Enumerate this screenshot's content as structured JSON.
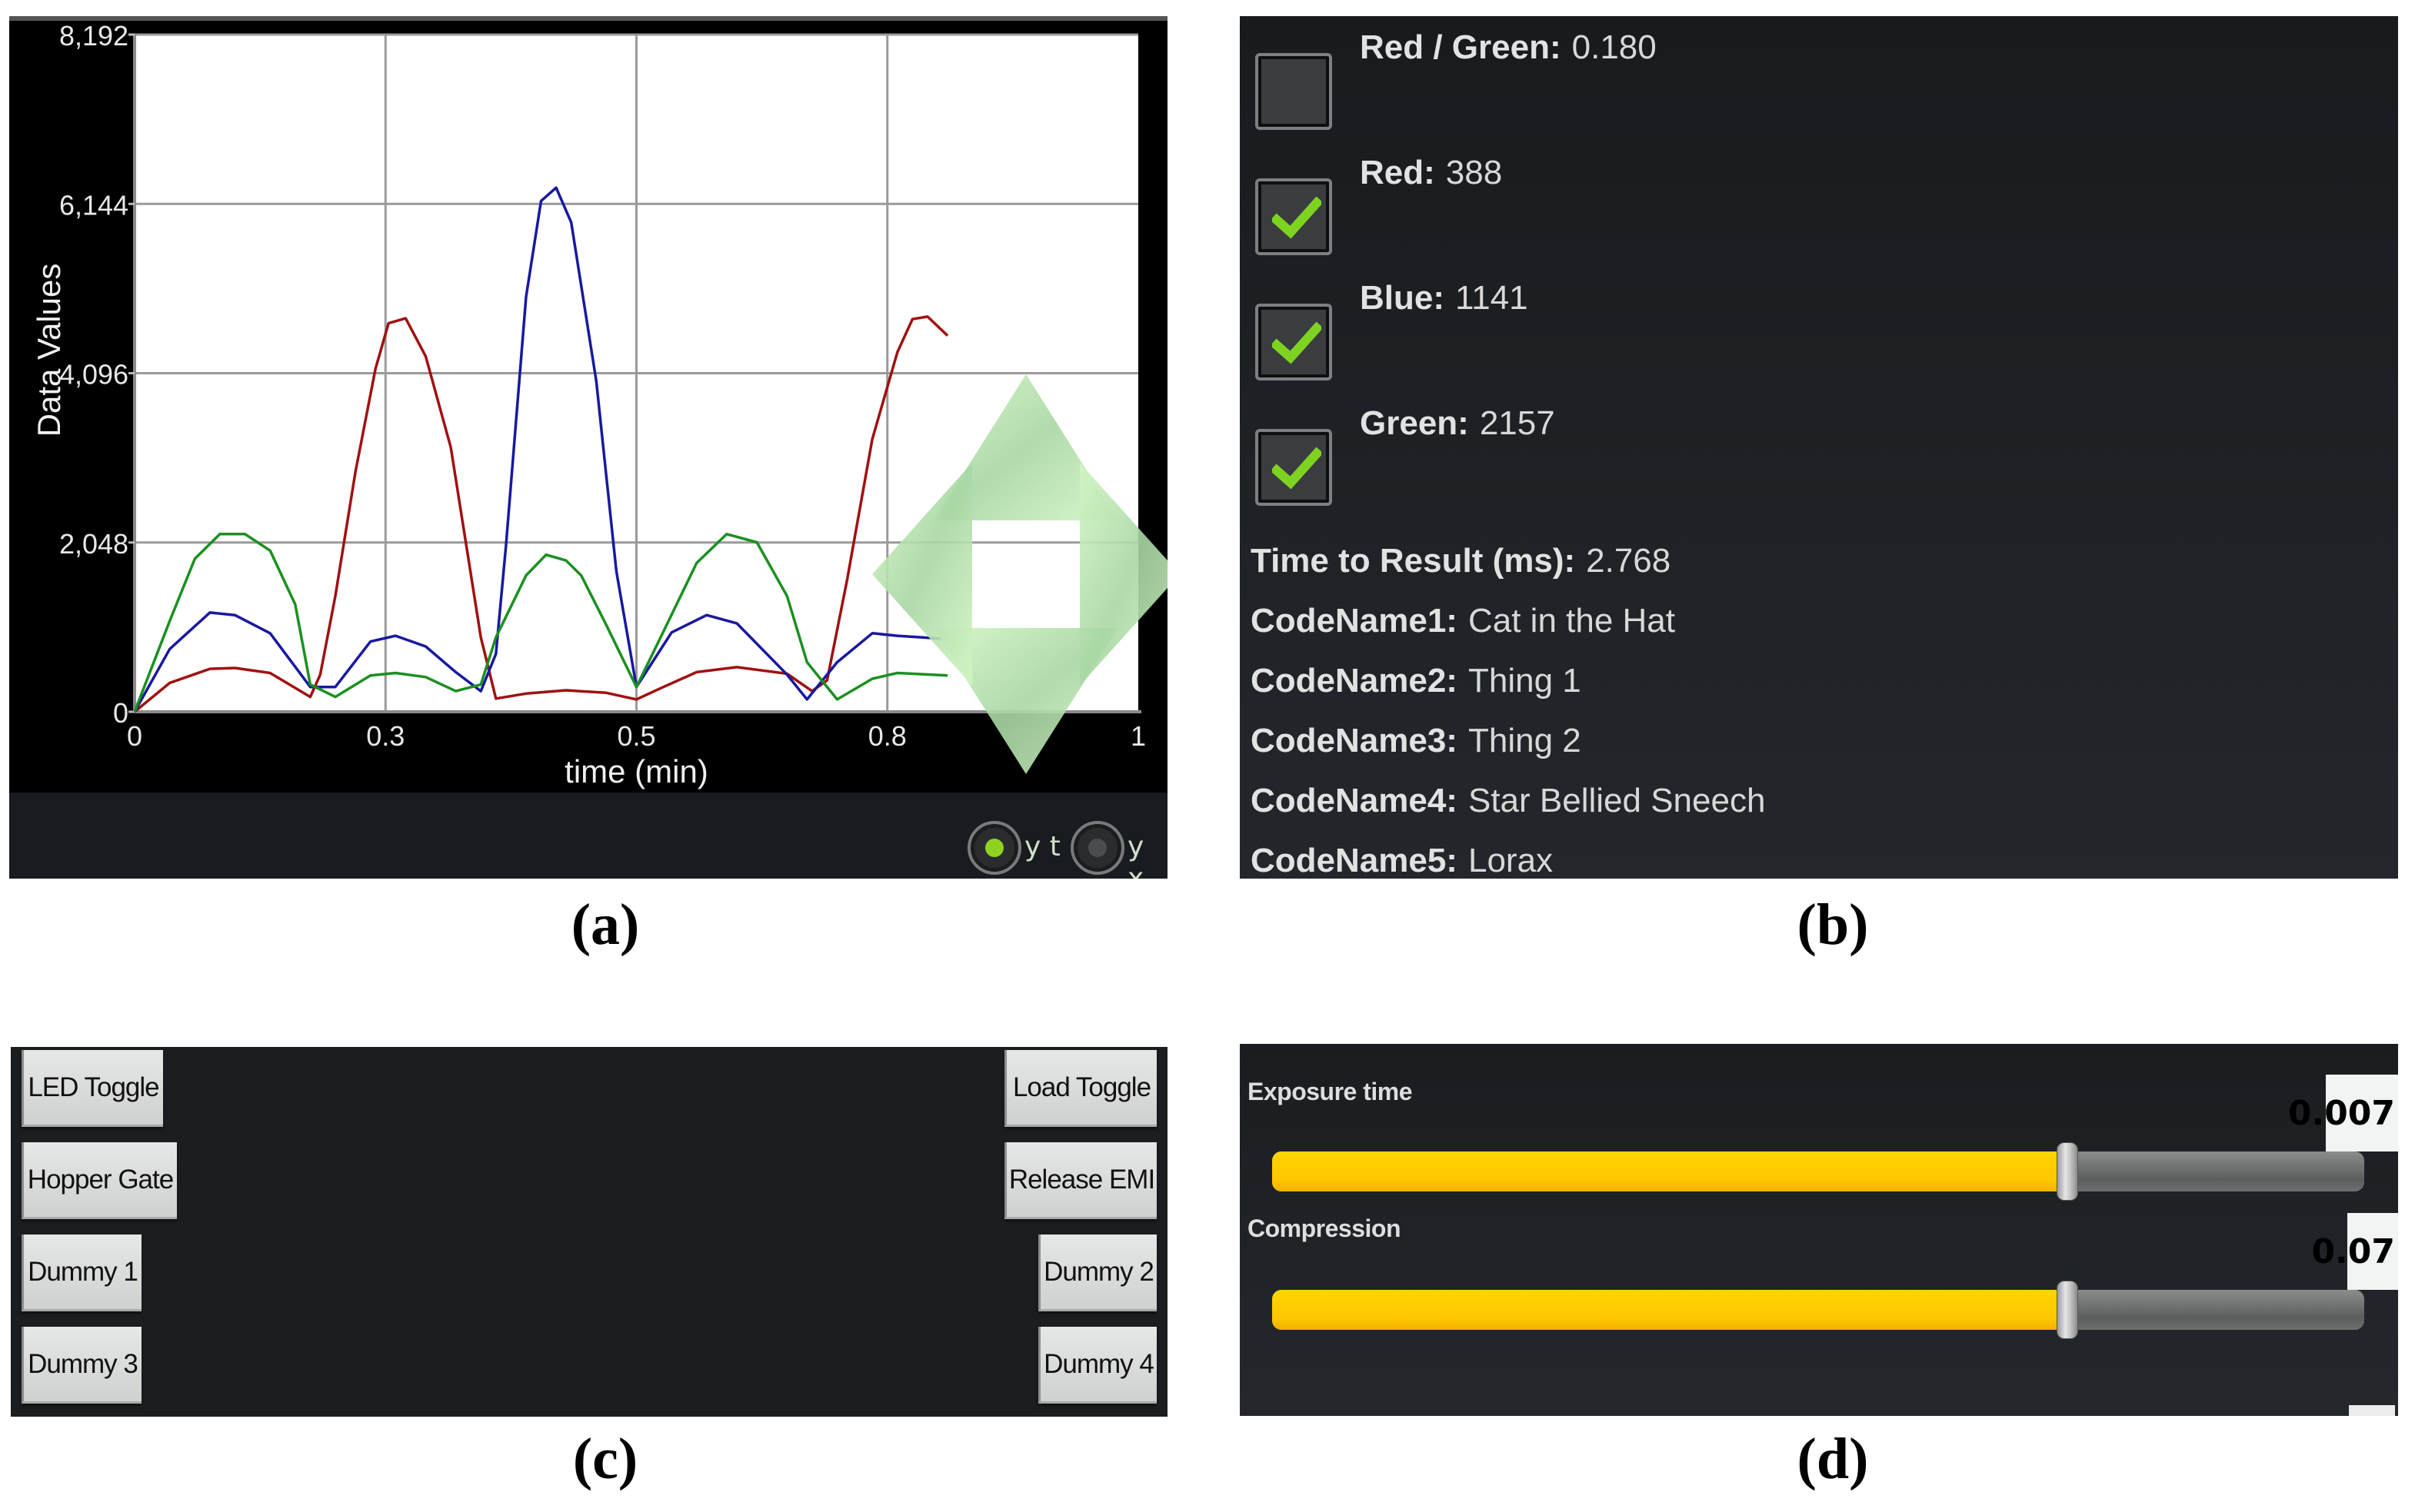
{
  "captions": {
    "a": "(a)",
    "b": "(b)",
    "c": "(c)",
    "d": "(d)"
  },
  "panel_a": {
    "radios": [
      {
        "label": "y t",
        "selected": true
      },
      {
        "label": "y x",
        "selected": false
      }
    ],
    "accent_color": "#8fd320",
    "pan_control_icon": "four-way-arrow-pad"
  },
  "chart_data": {
    "type": "line",
    "title": "",
    "xlabel": "time (min)",
    "ylabel": "Data Values",
    "xlim": [
      0,
      1
    ],
    "ylim": [
      0,
      8192
    ],
    "x_ticks": [
      0,
      0.25,
      0.5,
      0.75,
      1
    ],
    "x_tick_labels": [
      "0",
      "0.3",
      "0.5",
      "0.8",
      "1"
    ],
    "y_ticks": [
      0,
      2048,
      4096,
      6144,
      8192
    ],
    "y_tick_labels": [
      "0",
      "2,048",
      "4,096",
      "6,144",
      "8,192"
    ],
    "grid": true,
    "legend": "none",
    "series": [
      {
        "name": "Red",
        "color": "#a01010",
        "x": [
          0,
          0.035,
          0.075,
          0.1,
          0.135,
          0.175,
          0.185,
          0.2,
          0.22,
          0.24,
          0.253,
          0.27,
          0.29,
          0.315,
          0.345,
          0.36,
          0.39,
          0.43,
          0.47,
          0.5,
          0.525,
          0.56,
          0.6,
          0.65,
          0.675,
          0.69,
          0.71,
          0.735,
          0.76,
          0.775,
          0.79,
          0.81
        ],
        "y": [
          0,
          350,
          520,
          530,
          470,
          180,
          450,
          1400,
          2900,
          4150,
          4700,
          4760,
          4300,
          3200,
          900,
          160,
          220,
          260,
          230,
          150,
          290,
          480,
          540,
          460,
          250,
          380,
          1600,
          3300,
          4350,
          4750,
          4780,
          4550
        ]
      },
      {
        "name": "Blue",
        "color": "#1818a0",
        "x": [
          0,
          0.035,
          0.075,
          0.1,
          0.135,
          0.175,
          0.2,
          0.235,
          0.26,
          0.29,
          0.32,
          0.345,
          0.36,
          0.37,
          0.39,
          0.405,
          0.42,
          0.435,
          0.46,
          0.48,
          0.5,
          0.535,
          0.57,
          0.6,
          0.65,
          0.67,
          0.7,
          0.735,
          0.76,
          0.81
        ],
        "y": [
          0,
          760,
          1200,
          1170,
          950,
          300,
          300,
          850,
          920,
          790,
          480,
          250,
          700,
          2000,
          5020,
          6180,
          6340,
          5920,
          4000,
          1700,
          300,
          960,
          1170,
          1070,
          450,
          150,
          600,
          950,
          920,
          880
        ]
      },
      {
        "name": "Green",
        "color": "#1a9020",
        "x": [
          0,
          0.035,
          0.06,
          0.085,
          0.11,
          0.135,
          0.16,
          0.175,
          0.2,
          0.235,
          0.26,
          0.29,
          0.32,
          0.345,
          0.36,
          0.39,
          0.41,
          0.43,
          0.445,
          0.47,
          0.5,
          0.53,
          0.56,
          0.59,
          0.62,
          0.65,
          0.67,
          0.7,
          0.735,
          0.76,
          0.81
        ],
        "y": [
          0,
          1100,
          1850,
          2150,
          2150,
          1950,
          1300,
          330,
          180,
          440,
          470,
          420,
          250,
          330,
          900,
          1650,
          1900,
          1830,
          1650,
          1050,
          300,
          1050,
          1800,
          2150,
          2050,
          1400,
          600,
          150,
          400,
          470,
          440
        ]
      }
    ]
  },
  "panel_b": {
    "checkbox_rows": [
      {
        "label": "Red / Green:",
        "value": "0.180",
        "checked": false
      },
      {
        "label": "Red:",
        "value": "388",
        "checked": true
      },
      {
        "label": "Blue:",
        "value": "1141",
        "checked": true
      },
      {
        "label": "Green:",
        "value": "2157",
        "checked": true
      }
    ],
    "info_rows": [
      {
        "label": "Time to Result (ms):",
        "value": "2.768"
      },
      {
        "label": "CodeName1:",
        "value": "Cat in the Hat"
      },
      {
        "label": "CodeName2:",
        "value": "Thing 1"
      },
      {
        "label": "CodeName3:",
        "value": "Thing 2"
      },
      {
        "label": "CodeName4:",
        "value": "Star Bellied Sneech"
      },
      {
        "label": "CodeName5:",
        "value": "Lorax"
      }
    ],
    "check_color": "#7ed321"
  },
  "panel_c": {
    "buttons_left": [
      "LED Toggle",
      "Hopper Gate",
      "Dummy 1",
      "Dummy 3"
    ],
    "buttons_right": [
      "Load Toggle",
      "Release EMI",
      "Dummy 2",
      "Dummy 4"
    ]
  },
  "panel_d": {
    "sliders": [
      {
        "label": "Exposure time",
        "value": "0.007",
        "fraction": 0.728
      },
      {
        "label": "Compression",
        "value": "0.07",
        "fraction": 0.728
      }
    ],
    "fill_color": "#ffc800"
  }
}
